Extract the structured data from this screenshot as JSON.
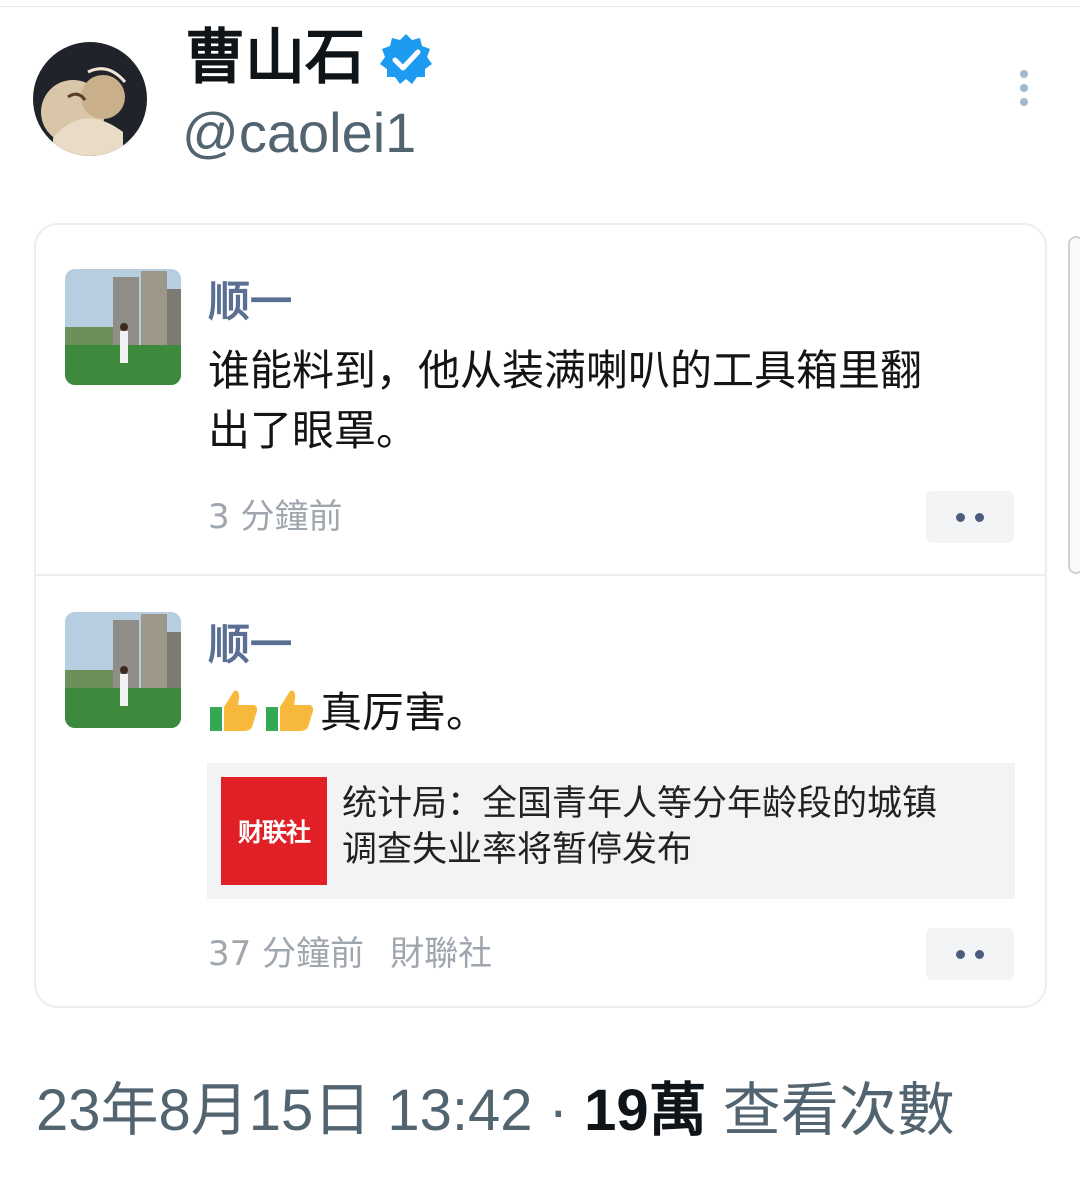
{
  "author": {
    "name": "曹山石",
    "handle": "@caolei1"
  },
  "quoted_posts": [
    {
      "username": "顺一",
      "text_line1": "谁能料到，他从装满喇叭的工具箱里翻",
      "text_line2": "出了眼罩。",
      "time": "3 分鐘前"
    },
    {
      "username": "顺一",
      "text": "真厉害。",
      "link_card": {
        "logo_text": "财联社",
        "title_line1": "统计局：全国青年人等分年龄段的城镇",
        "title_line2": "调查失业率将暂停发布"
      },
      "time": "37 分鐘前",
      "source": "財聯社"
    }
  ],
  "tweet": {
    "datetime": "23年8月15日 13:42 · ",
    "views_count": "19萬",
    "views_label": " 查看次數"
  },
  "colors": {
    "verified": "#1d9bf0",
    "quoted_name": "#5a6f92",
    "logo_red": "#e01f26"
  }
}
